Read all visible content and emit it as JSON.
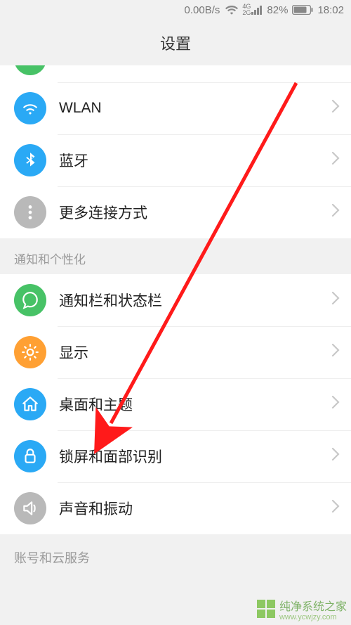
{
  "status": {
    "speed": "0.00B/s",
    "network_label_top": "4G",
    "network_label_bot": "2G",
    "battery_pct": "82%",
    "time": "18:02"
  },
  "header": {
    "title": "设置"
  },
  "sections": {
    "connectivity": {
      "items": [
        {
          "icon": "transfer",
          "label": ""
        },
        {
          "icon": "wifi",
          "label": "WLAN"
        },
        {
          "icon": "bluetooth",
          "label": "蓝牙"
        },
        {
          "icon": "more",
          "label": "更多连接方式"
        }
      ]
    },
    "personalize": {
      "heading": "通知和个性化",
      "items": [
        {
          "icon": "notification",
          "label": "通知栏和状态栏"
        },
        {
          "icon": "display",
          "label": "显示"
        },
        {
          "icon": "home",
          "label": "桌面和主题"
        },
        {
          "icon": "lock",
          "label": "锁屏和面部识别"
        },
        {
          "icon": "sound",
          "label": "声音和振动"
        }
      ]
    },
    "account": {
      "heading": "账号和云服务"
    }
  },
  "watermark": {
    "text": "纯净系统之家",
    "url": "www.ycwjzy.com"
  }
}
